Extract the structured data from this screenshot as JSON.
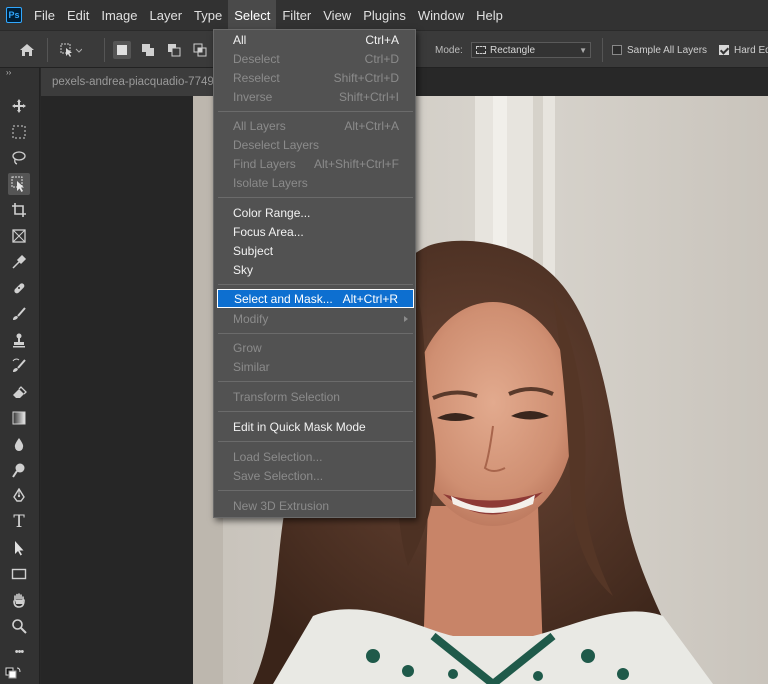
{
  "app": {
    "logo": "Ps",
    "menu": [
      "File",
      "Edit",
      "Image",
      "Layer",
      "Type",
      "Select",
      "Filter",
      "View",
      "Plugins",
      "Window",
      "Help"
    ],
    "active_menu": "Select"
  },
  "options_bar": {
    "mode_label": "Mode:",
    "mode_value": "Rectangle",
    "sample_all_layers": "Sample All Layers",
    "sample_all_layers_checked": false,
    "hard_edge": "Hard Ed",
    "hard_edge_checked": true
  },
  "toolbar": {
    "collapse_glyph": "››",
    "tools": [
      "move-icon",
      "marquee-icon",
      "lasso-icon",
      "object-selection-icon",
      "crop-icon",
      "frame-icon",
      "eyedropper-icon",
      "healing-brush-icon",
      "brush-icon",
      "clone-stamp-icon",
      "history-brush-icon",
      "eraser-icon",
      "gradient-icon",
      "blur-icon",
      "dodge-icon",
      "pen-icon",
      "type-icon",
      "path-selection-icon",
      "rectangle-icon",
      "hand-icon",
      "zoom-icon",
      "more-tools-icon",
      "swap-colors-icon"
    ],
    "selected_tool": "object-selection-icon",
    "type_tool_glyph": "T",
    "more_glyph": "•••"
  },
  "document": {
    "tab_title": "pexels-andrea-piacquadio-7749"
  },
  "select_menu": {
    "groups": [
      [
        {
          "label": "All",
          "shortcut": "Ctrl+A",
          "enabled": true
        },
        {
          "label": "Deselect",
          "shortcut": "Ctrl+D",
          "enabled": false
        },
        {
          "label": "Reselect",
          "shortcut": "Shift+Ctrl+D",
          "enabled": false
        },
        {
          "label": "Inverse",
          "shortcut": "Shift+Ctrl+I",
          "enabled": false
        }
      ],
      [
        {
          "label": "All Layers",
          "shortcut": "Alt+Ctrl+A",
          "enabled": false
        },
        {
          "label": "Deselect Layers",
          "shortcut": "",
          "enabled": false
        },
        {
          "label": "Find Layers",
          "shortcut": "Alt+Shift+Ctrl+F",
          "enabled": false
        },
        {
          "label": "Isolate Layers",
          "shortcut": "",
          "enabled": false
        }
      ],
      [
        {
          "label": "Color Range...",
          "shortcut": "",
          "enabled": true
        },
        {
          "label": "Focus Area...",
          "shortcut": "",
          "enabled": true
        },
        {
          "label": "Subject",
          "shortcut": "",
          "enabled": true
        },
        {
          "label": "Sky",
          "shortcut": "",
          "enabled": true
        }
      ],
      [
        {
          "label": "Select and Mask...",
          "shortcut": "Alt+Ctrl+R",
          "enabled": true,
          "highlighted": true
        },
        {
          "label": "Modify",
          "shortcut": "",
          "enabled": false,
          "submenu": true
        }
      ],
      [
        {
          "label": "Grow",
          "shortcut": "",
          "enabled": false
        },
        {
          "label": "Similar",
          "shortcut": "",
          "enabled": false
        }
      ],
      [
        {
          "label": "Transform Selection",
          "shortcut": "",
          "enabled": false
        }
      ],
      [
        {
          "label": "Edit in Quick Mask Mode",
          "shortcut": "",
          "enabled": true
        }
      ],
      [
        {
          "label": "Load Selection...",
          "shortcut": "",
          "enabled": false
        },
        {
          "label": "Save Selection...",
          "shortcut": "",
          "enabled": false
        }
      ],
      [
        {
          "label": "New 3D Extrusion",
          "shortcut": "",
          "enabled": false
        }
      ]
    ]
  }
}
